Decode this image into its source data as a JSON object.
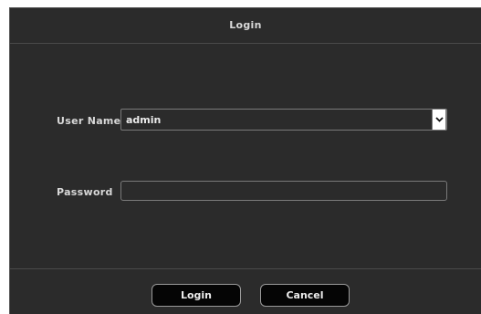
{
  "dialog": {
    "title": "Login"
  },
  "form": {
    "username_label": "User Name",
    "username_value": "admin",
    "password_label": "Password",
    "password_value": ""
  },
  "buttons": {
    "login_label": "Login",
    "cancel_label": "Cancel"
  },
  "icons": {
    "dropdown": "chevron-down-icon"
  }
}
